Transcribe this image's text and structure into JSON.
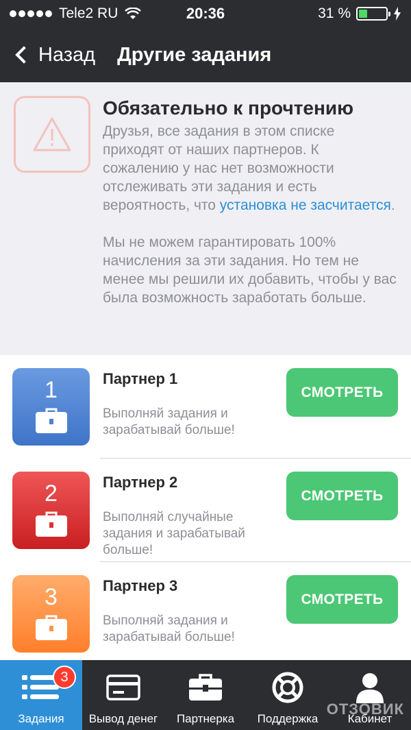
{
  "status": {
    "carrier": "Tele2 RU",
    "time": "20:36",
    "battery": "31 %",
    "battery_level": 0.31
  },
  "nav": {
    "back_label": "Назад",
    "title": "Другие задания"
  },
  "notice": {
    "title": "Обязательно к прочтению",
    "para1": "Друзья, все задания в этом списке приходят от наших партнеров. К сожалению у нас нет возможности отслеживать эти задания и есть вероятность, что ",
    "para1_link": "установка не засчитается",
    "para1_end": ".",
    "para2": "Мы не можем гарантировать 100% начисления за эти задания. Но тем не менее мы решили их добавить, чтобы у вас была возможность заработать больше."
  },
  "partners": [
    {
      "number": "1",
      "name": "Партнер 1",
      "description": "Выполняй задания и зарабатывай больше!",
      "button": "СМОТРЕТЬ",
      "color": "#4f82d2"
    },
    {
      "number": "2",
      "name": "Партнер 2",
      "description": "Выполняй случайные задания и зарабатывай больше!",
      "button": "СМОТРЕТЬ",
      "color": "#dd3436"
    },
    {
      "number": "3",
      "name": "Партнер 3",
      "description": "Выполняй задания и зарабатывай больше!",
      "button": "СМОТРЕТЬ",
      "color": "#ff9547"
    }
  ],
  "tabs": [
    {
      "label": "Задания",
      "icon": "list-icon",
      "badge": "3"
    },
    {
      "label": "Вывод денег",
      "icon": "card-icon"
    },
    {
      "label": "Партнерка",
      "icon": "briefcase-icon"
    },
    {
      "label": "Поддержка",
      "icon": "lifebuoy-icon"
    },
    {
      "label": "Кабинет",
      "icon": "user-icon"
    }
  ],
  "watermark": "ОТЗОВИК",
  "colors": {
    "accent": "#2f8fd6",
    "button": "#4cc775",
    "dark": "#2c2d30"
  }
}
